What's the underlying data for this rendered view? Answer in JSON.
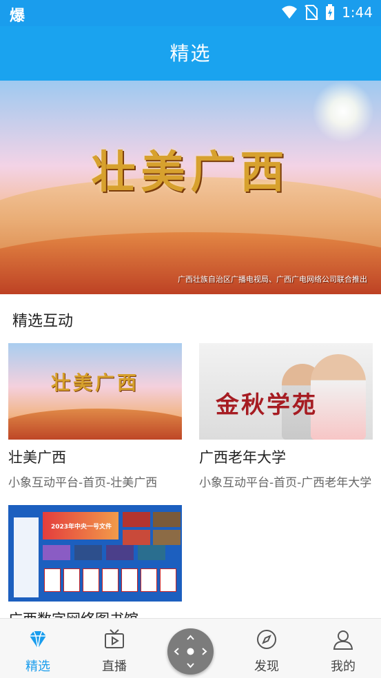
{
  "status_bar": {
    "app_logo": "爆",
    "time": "1:44",
    "icons": [
      "wifi-icon",
      "no-sim-icon",
      "battery-charging-icon"
    ]
  },
  "app_bar": {
    "title": "精选"
  },
  "banner": {
    "title": "壮美广西",
    "credit": "广西壮族自治区广播电视局、广西广电网络公司联合推出"
  },
  "section": {
    "title": "精选互动"
  },
  "cards": [
    {
      "thumb_text": "壮美广西",
      "name": "壮美广西",
      "desc": "小象互动平台-首页-壮美广西"
    },
    {
      "thumb_text": "金秋学苑",
      "name": "广西老年大学",
      "desc": "小象互动平台-首页-广西老年大学"
    },
    {
      "thumb_text": "2023年中央一号文件",
      "name": "广西数字网络图书馆",
      "desc": ""
    }
  ],
  "tabbar": {
    "items": [
      {
        "label": "精选",
        "icon": "diamond-icon",
        "active": true
      },
      {
        "label": "直播",
        "icon": "tv-icon",
        "active": false
      },
      {
        "label": "发现",
        "icon": "compass-icon",
        "active": false
      },
      {
        "label": "我的",
        "icon": "user-icon",
        "active": false
      }
    ],
    "center_button_icon": "remote-dpad-icon"
  },
  "colors": {
    "accent": "#1a9ded",
    "status_bar": "#1a9ded",
    "app_bar": "#1aa3ef",
    "tabbar_bg": "#f7f7f7",
    "fab": "#7c7c7c"
  }
}
